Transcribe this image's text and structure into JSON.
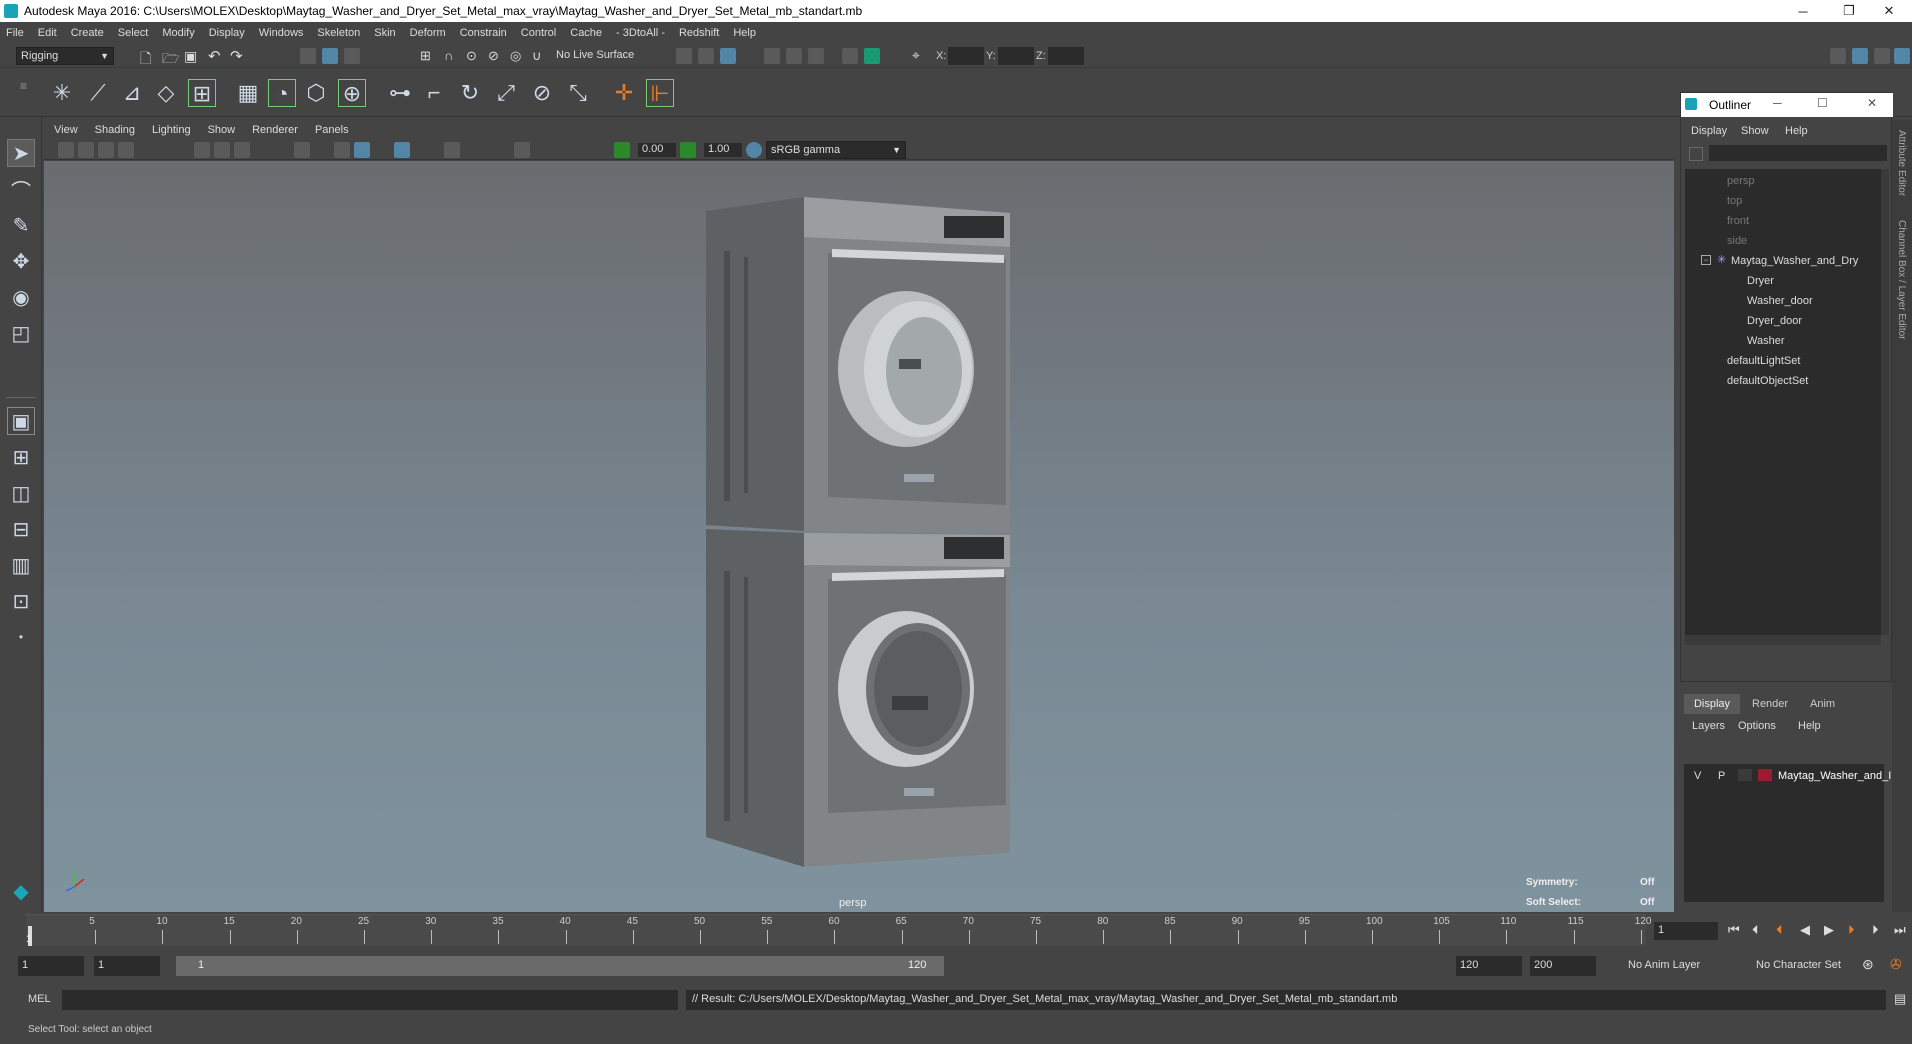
{
  "window": {
    "title": "Autodesk Maya 2016: C:\\Users\\MOLEX\\Desktop\\Maytag_Washer_and_Dryer_Set_Metal_max_vray\\Maytag_Washer_and_Dryer_Set_Metal_mb_standart.mb",
    "minimize": "─",
    "maximize": "❐",
    "close": "✕"
  },
  "menubar": [
    "File",
    "Edit",
    "Create",
    "Select",
    "Modify",
    "Display",
    "Windows",
    "Skeleton",
    "Skin",
    "Deform",
    "Constrain",
    "Control",
    "Cache",
    "- 3DtoAll -",
    "Redshift",
    "Help"
  ],
  "statusline": {
    "mode": "Rigging",
    "live_surface": "No Live Surface",
    "x_label": "X:",
    "y_label": "Y:",
    "z_label": "Z:"
  },
  "panel": {
    "menus": [
      "View",
      "Shading",
      "Lighting",
      "Show",
      "Renderer",
      "Panels"
    ],
    "exposure": "0.00",
    "gamma": "1.00",
    "color_space": "sRGB gamma"
  },
  "viewport": {
    "camera_label": "persp",
    "symmetry_label": "Symmetry:",
    "symmetry_value": "Off",
    "soft_select_label": "Soft Select:",
    "soft_select_value": "Off"
  },
  "outliner": {
    "title": "Outliner",
    "menus": [
      "Display",
      "Show",
      "Help"
    ],
    "items": [
      {
        "label": "persp",
        "type": "camera",
        "dim": true
      },
      {
        "label": "top",
        "type": "camera",
        "dim": true
      },
      {
        "label": "front",
        "type": "camera",
        "dim": true
      },
      {
        "label": "side",
        "type": "camera",
        "dim": true
      },
      {
        "label": "Maytag_Washer_and_Dry",
        "type": "group",
        "dim": false
      },
      {
        "label": "Dryer",
        "type": "mesh",
        "dim": false
      },
      {
        "label": "Washer_door",
        "type": "mesh",
        "dim": false
      },
      {
        "label": "Dryer_door",
        "type": "mesh",
        "dim": false
      },
      {
        "label": "Washer",
        "type": "mesh",
        "dim": false
      },
      {
        "label": "defaultLightSet",
        "type": "set",
        "dim": false
      },
      {
        "label": "defaultObjectSet",
        "type": "set",
        "dim": false
      }
    ]
  },
  "channel": {
    "tabs": [
      "Display",
      "Render",
      "Anim"
    ],
    "menus": [
      "Layers",
      "Options",
      "Help"
    ],
    "layer": {
      "v": "V",
      "p": "P",
      "name": "Maytag_Washer_and_I",
      "color": "#9b1b30"
    }
  },
  "side_tabs": [
    "Attribute Editor",
    "Channel Box / Layer Editor"
  ],
  "timeline": {
    "ticks": [
      "5",
      "10",
      "15",
      "20",
      "25",
      "30",
      "35",
      "40",
      "45",
      "50",
      "55",
      "60",
      "65",
      "70",
      "75",
      "80",
      "85",
      "90",
      "95",
      "100",
      "105",
      "110",
      "115",
      "120"
    ],
    "start_marker": "1",
    "current_frame": "1"
  },
  "range": {
    "start": "1",
    "playback_start": "1",
    "slider_start": "1",
    "slider_end": "120",
    "playback_end": "120",
    "end": "200",
    "anim_layer": "No Anim Layer",
    "character_set": "No Character Set"
  },
  "command": {
    "mode": "MEL",
    "result": "// Result: C:/Users/MOLEX/Desktop/Maytag_Washer_and_Dryer_Set_Metal_max_vray/Maytag_Washer_and_Dryer_Set_Metal_mb_standart.mb"
  },
  "help_line": "Select Tool: select an object",
  "colors": {
    "accent": "#5285a6",
    "layer": "#9b1b30",
    "bg": "#444444"
  }
}
